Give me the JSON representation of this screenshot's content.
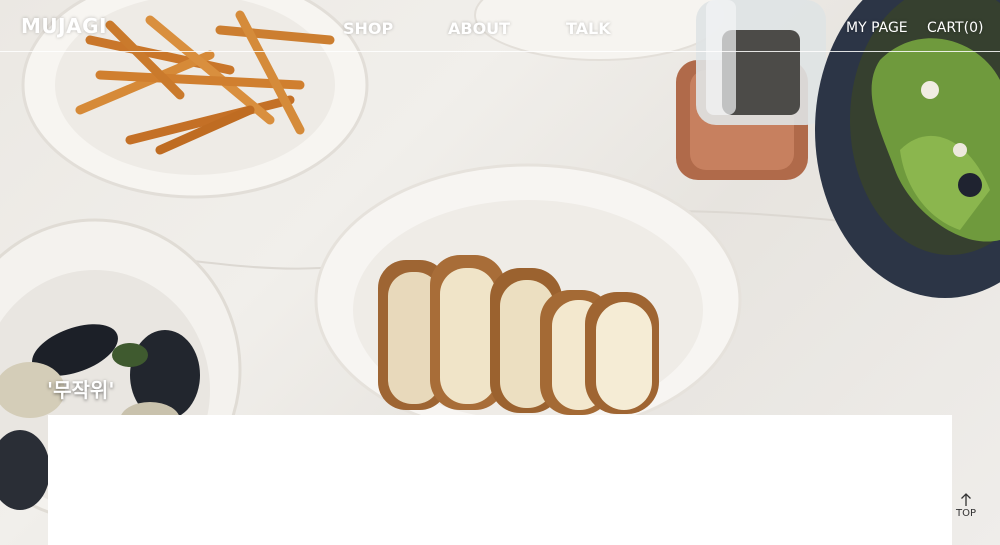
{
  "header": {
    "logo": "MUJAGI",
    "nav": [
      {
        "label": "SHOP"
      },
      {
        "label": "ABOUT"
      },
      {
        "label": "TALK"
      }
    ],
    "my_page": "MY PAGE",
    "cart": "CART(0)"
  },
  "hero": {
    "caption": "'무작위'"
  },
  "top_button": {
    "label": "TOP",
    "icon": "arrow-up-icon"
  },
  "colors": {
    "nav_text": "#ffffff",
    "panel": "#ffffff",
    "table": "#ebe8e3"
  }
}
